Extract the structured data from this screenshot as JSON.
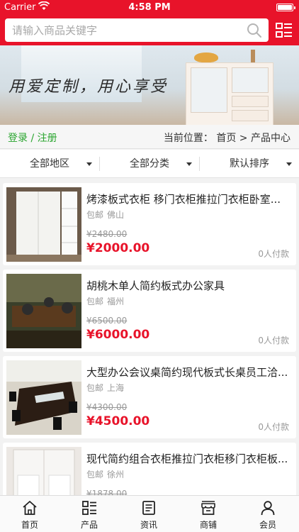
{
  "status_bar": {
    "carrier": "Carrier",
    "time": "4:58 PM"
  },
  "search": {
    "placeholder": "请输入商品关键字"
  },
  "banner": {
    "slogan": "用爱定制，用心享受"
  },
  "auth": {
    "login_register": "登录 / 注册"
  },
  "breadcrumb": {
    "text": "当前位置： 首页 > 产品中心"
  },
  "filters": [
    {
      "label": "全部地区"
    },
    {
      "label": "全部分类"
    },
    {
      "label": "默认排序"
    }
  ],
  "products": [
    {
      "title": "烤漆板式衣柜 移门衣柜推拉门衣柜卧室...",
      "shipping": "包邮",
      "city": "佛山",
      "old_price": "¥2480.00",
      "price": "¥2000.00",
      "paid": "0人付款"
    },
    {
      "title": "胡桃木单人简约板式办公家具",
      "shipping": "包邮",
      "city": "福州",
      "old_price": "¥6500.00",
      "price": "¥6000.00",
      "paid": "0人付款"
    },
    {
      "title": "大型办公会议桌简约现代板式长桌员工洽...",
      "shipping": "包邮",
      "city": "上海",
      "old_price": "¥4300.00",
      "price": "¥4500.00",
      "paid": "0人付款"
    },
    {
      "title": "现代简约组合衣柜推拉门衣柜移门衣柜板...",
      "shipping": "包邮",
      "city": "徐州",
      "old_price": "¥1878.00",
      "price": "",
      "paid": ""
    }
  ],
  "tabbar": [
    {
      "label": "首页",
      "icon": "home-icon"
    },
    {
      "label": "产品",
      "icon": "list-icon"
    },
    {
      "label": "资讯",
      "icon": "news-icon"
    },
    {
      "label": "商铺",
      "icon": "shop-icon"
    },
    {
      "label": "会员",
      "icon": "user-icon"
    }
  ],
  "colors": {
    "accent": "#e8132a",
    "link_green": "#2aa52f"
  }
}
